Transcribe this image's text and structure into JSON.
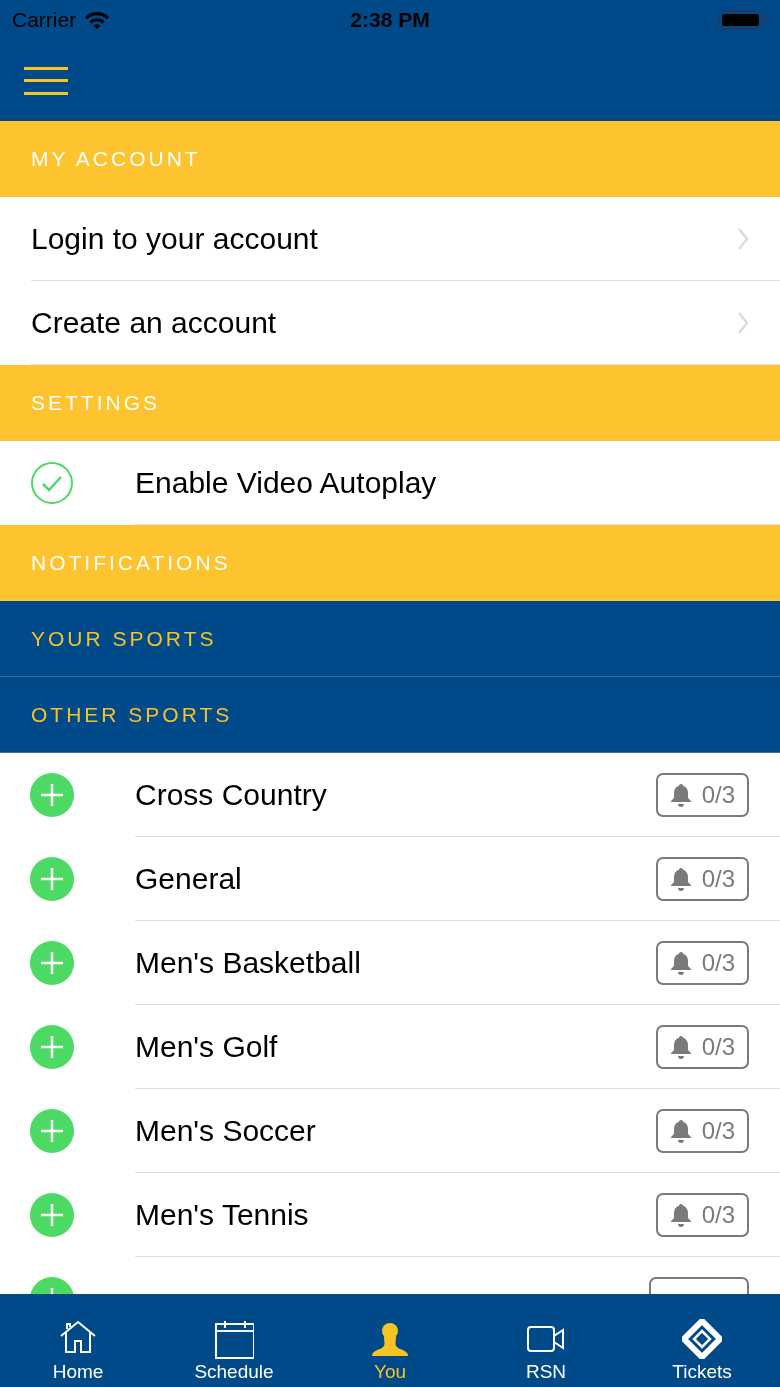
{
  "status_bar": {
    "carrier": "Carrier",
    "time": "2:38 PM"
  },
  "items": [
    {
      "kind": "section",
      "title": "MY ACCOUNT"
    },
    {
      "kind": "link",
      "label": "Login to your account"
    },
    {
      "kind": "link",
      "label": "Create an account"
    },
    {
      "kind": "section",
      "title": "SETTINGS"
    },
    {
      "kind": "toggle",
      "label": "Enable Video Autoplay",
      "checked": true
    },
    {
      "kind": "section",
      "title": "NOTIFICATIONS"
    },
    {
      "kind": "group",
      "title": "YOUR SPORTS"
    },
    {
      "kind": "group",
      "title": "OTHER SPORTS"
    },
    {
      "kind": "sport",
      "label": "Cross Country",
      "count": "0/3"
    },
    {
      "kind": "sport",
      "label": "General",
      "count": "0/3"
    },
    {
      "kind": "sport",
      "label": "Men's Basketball",
      "count": "0/3"
    },
    {
      "kind": "sport",
      "label": "Men's Golf",
      "count": "0/3"
    },
    {
      "kind": "sport",
      "label": "Men's Soccer",
      "count": "0/3"
    },
    {
      "kind": "sport",
      "label": "Men's Tennis",
      "count": "0/3"
    },
    {
      "kind": "peek"
    }
  ],
  "tabs": [
    {
      "kind": "home",
      "label": "Home",
      "selected": false
    },
    {
      "kind": "schedule",
      "label": "Schedule",
      "selected": false
    },
    {
      "kind": "you",
      "label": "You",
      "selected": true
    },
    {
      "kind": "video",
      "label": "RSN",
      "selected": false
    },
    {
      "kind": "ticket",
      "label": "Tickets",
      "selected": false
    }
  ]
}
